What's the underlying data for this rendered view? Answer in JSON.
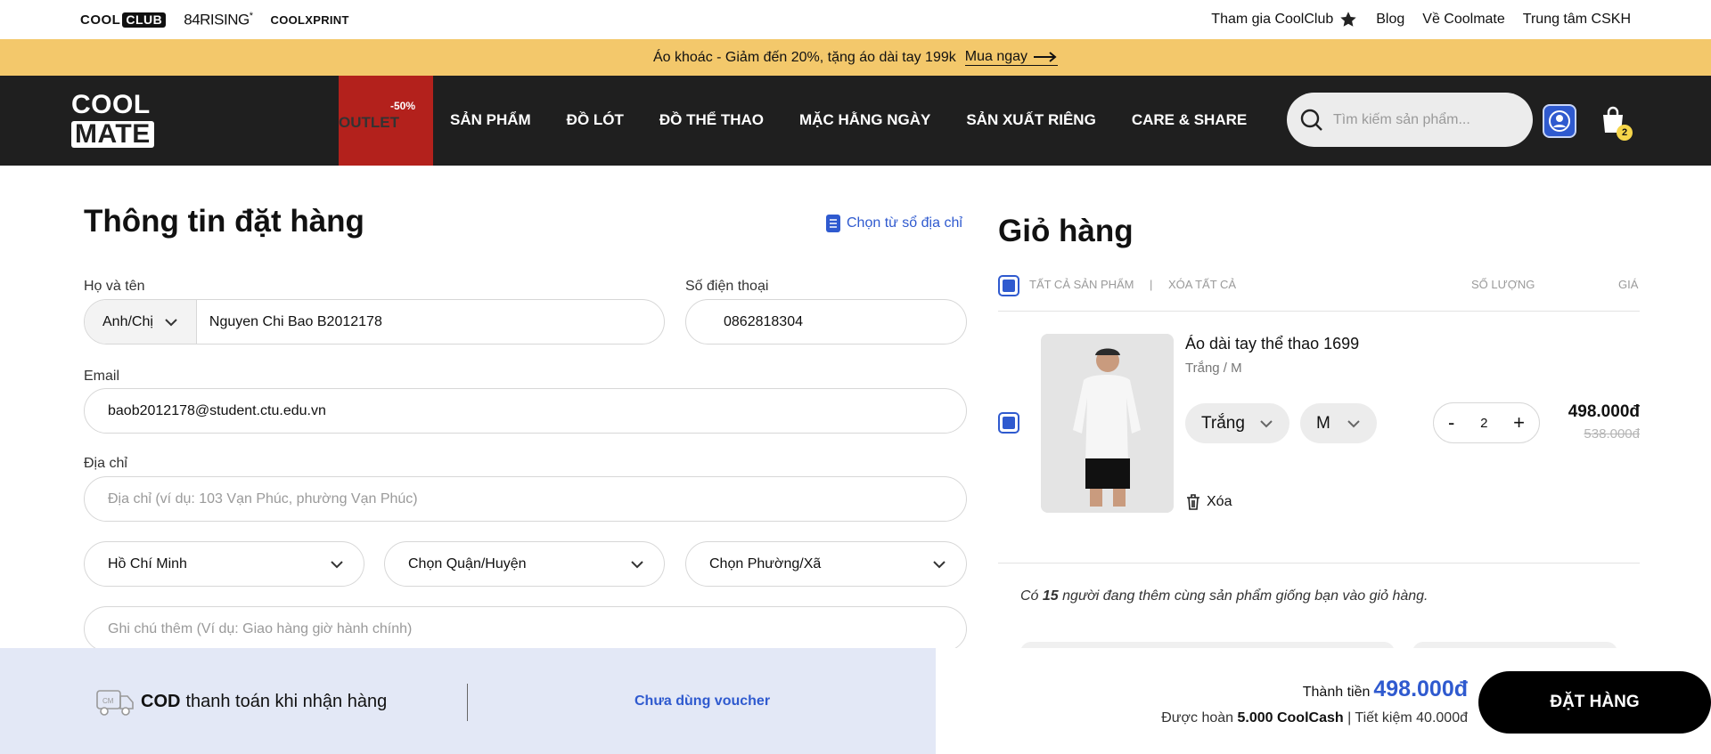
{
  "topbar": {
    "brands": {
      "coolclub_a": "COOL",
      "coolclub_b": "CLUB",
      "rising": "84RISING",
      "rising_mark": "*",
      "coolxprint": "COOLXPRINT"
    },
    "links": [
      "Tham gia CoolClub",
      "Blog",
      "Về Coolmate",
      "Trung tâm CSKH"
    ],
    "star_icon": "star-icon"
  },
  "promo": {
    "text": "Áo khoác - Giảm đến 20%, tặng áo dài tay 199k",
    "cta": "Mua ngay"
  },
  "nav": {
    "logo_line1": "COOL",
    "logo_line2": "MATE",
    "outlet_pct": "-50%",
    "outlet_label": "OUTLET",
    "menu": [
      "SẢN PHẨM",
      "ĐỒ LÓT",
      "ĐỒ THỂ THAO",
      "MẶC HẰNG NGÀY",
      "SẢN XUẤT RIÊNG",
      "CARE & SHARE"
    ],
    "search_placeholder": "Tìm kiếm sản phẩm...",
    "cart_count": "2",
    "outlet_color": "#b3211c",
    "bg_color": "#1f1f1f"
  },
  "form": {
    "title": "Thông tin đặt hàng",
    "address_book": "Chọn từ sổ địa chỉ",
    "name_label": "Họ và tên",
    "salutation": "Anh/Chị",
    "name_value": "Nguyen Chi Bao B2012178",
    "phone_label": "Số điện thoại",
    "phone_value": "0862818304",
    "email_label": "Email",
    "email_value": "baob2012178@student.ctu.edu.vn",
    "address_label": "Địa chỉ",
    "address_placeholder": "Địa chỉ (ví dụ: 103 Vạn Phúc, phường Vạn Phúc)",
    "city": "Hồ Chí Minh",
    "district": "Chọn Quận/Huyện",
    "ward": "Chọn Phường/Xã",
    "note_placeholder": "Ghi chú thêm (Ví dụ: Giao hàng giờ hành chính)"
  },
  "cart": {
    "title": "Giỏ hàng",
    "select_all": "TẤT CẢ SẢN PHẨM",
    "sep": "|",
    "clear_all": "XÓA TẤT CẢ",
    "qty_header": "SỐ LƯỢNG",
    "price_header": "GIÁ",
    "item": {
      "name": "Áo dài tay thể thao 1699",
      "variant": "Trắng / M",
      "color": "Trắng",
      "size": "M",
      "minus": "-",
      "qty": "2",
      "plus": "+",
      "price": "498.000đ",
      "old_price": "538.000đ",
      "remove": "Xóa"
    },
    "note_prefix": "Có",
    "note_count": "15",
    "note_suffix": "người đang thêm cùng sản phẩm giống bạn vào giỏ hàng."
  },
  "footer": {
    "cod_bold": "COD",
    "cod_text": "thanh toán khi nhận hàng",
    "voucher": "Chưa dùng voucher",
    "total_label": "Thành tiền",
    "total_value": "498.000đ",
    "cash_prefix": "Được hoàn",
    "cash_value": "5.000 CoolCash",
    "cash_sep": "|",
    "savings": "Tiết kiệm 40.000đ",
    "order_btn": "ĐẶT HÀNG",
    "accent": "#2f5acf"
  }
}
